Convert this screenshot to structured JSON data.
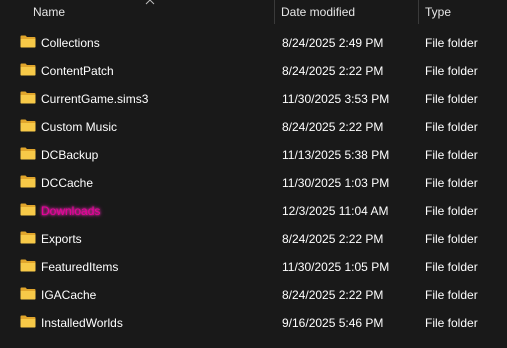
{
  "columns": {
    "name": "Name",
    "date_modified": "Date modified",
    "type": "Type"
  },
  "icons": {
    "folder": "folder-icon",
    "sort": "sort-ascending-icon"
  },
  "colors": {
    "background": "#191919",
    "folder": "#f5c342",
    "highlight_text": "#e8009a"
  },
  "files": [
    {
      "name": "Collections",
      "date": "8/24/2025 2:49 PM",
      "type": "File folder"
    },
    {
      "name": "ContentPatch",
      "date": "8/24/2025 2:22 PM",
      "type": "File folder"
    },
    {
      "name": "CurrentGame.sims3",
      "date": "11/30/2025 3:53 PM",
      "type": "File folder"
    },
    {
      "name": "Custom Music",
      "date": "8/24/2025 2:22 PM",
      "type": "File folder"
    },
    {
      "name": "DCBackup",
      "date": "11/13/2025 5:38 PM",
      "type": "File folder"
    },
    {
      "name": "DCCache",
      "date": "11/30/2025 1:03 PM",
      "type": "File folder"
    },
    {
      "name": "Downloads",
      "date": "12/3/2025 11:04 AM",
      "type": "File folder",
      "highlighted": true
    },
    {
      "name": "Exports",
      "date": "8/24/2025 2:22 PM",
      "type": "File folder"
    },
    {
      "name": "FeaturedItems",
      "date": "11/30/2025 1:05 PM",
      "type": "File folder"
    },
    {
      "name": "IGACache",
      "date": "8/24/2025 2:22 PM",
      "type": "File folder"
    },
    {
      "name": "InstalledWorlds",
      "date": "9/16/2025 5:46 PM",
      "type": "File folder"
    }
  ]
}
